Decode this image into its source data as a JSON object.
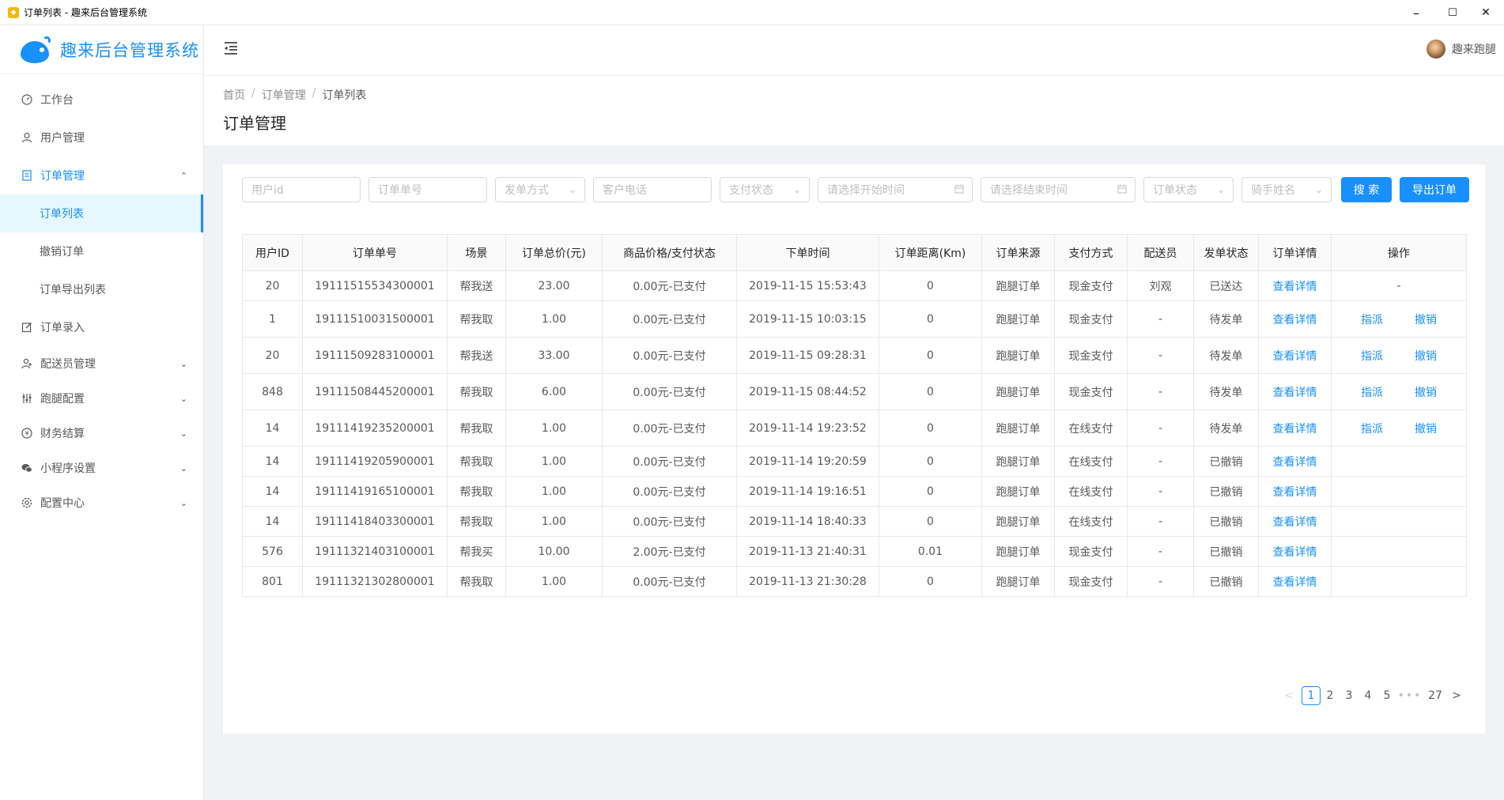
{
  "window": {
    "title": "订单列表 - 趣来后台管理系统",
    "minimize": "–",
    "maximize": "☐",
    "close": "✕"
  },
  "brand": {
    "name": "趣来后台管理系统"
  },
  "sidebar": {
    "items": [
      {
        "label": "工作台",
        "icon": "dashboard-icon"
      },
      {
        "label": "用户管理",
        "icon": "user-icon"
      },
      {
        "label": "订单管理",
        "icon": "file-icon",
        "open": true,
        "children": [
          {
            "label": "订单列表",
            "active": true
          },
          {
            "label": "撤销订单"
          },
          {
            "label": "订单导出列表"
          }
        ]
      },
      {
        "label": "订单录入",
        "icon": "edit-icon"
      },
      {
        "label": "配送员管理",
        "icon": "courier-icon",
        "arrow": true
      },
      {
        "label": "跑腿配置",
        "icon": "sliders-icon",
        "arrow": true
      },
      {
        "label": "财务结算",
        "icon": "money-icon",
        "arrow": true
      },
      {
        "label": "小程序设置",
        "icon": "wechat-icon",
        "arrow": true
      },
      {
        "label": "配置中心",
        "icon": "gear-icon",
        "arrow": true
      }
    ]
  },
  "header": {
    "username": "趣来跑腿"
  },
  "breadcrumb": [
    "首页",
    "订单管理",
    "订单列表"
  ],
  "page_title": "订单管理",
  "filters": {
    "user_id": "用户id",
    "order_no": "订单单号",
    "dispatch_mode": "发单方式",
    "customer_phone": "客户电话",
    "pay_status": "支付状态",
    "start_time": "请选择开始时间",
    "end_time": "请选择结束时间",
    "order_status": "订单状态",
    "rider_name": "骑手姓名",
    "search_label": "搜 索",
    "export_label": "导出订单"
  },
  "table": {
    "columns": [
      "用户ID",
      "订单单号",
      "场景",
      "订单总价(元)",
      "商品价格/支付状态",
      "下单时间",
      "订单距离(Km)",
      "订单来源",
      "支付方式",
      "配送员",
      "发单状态",
      "订单详情",
      "操作"
    ],
    "detail_label": "查看详情",
    "assign_label": "指派",
    "revoke_label": "撤销",
    "rows": [
      {
        "user_id": "20",
        "order_no": "19111515534300001",
        "scene": "帮我送",
        "total": "23.00",
        "goods": "0.00元-已支付",
        "time": "2019-11-15 15:53:43",
        "distance": "0",
        "source": "跑腿订单",
        "pay": "现金支付",
        "courier": "刘观",
        "status": "已送达",
        "op": "-"
      },
      {
        "user_id": "1",
        "order_no": "19111510031500001",
        "scene": "帮我取",
        "total": "1.00",
        "goods": "0.00元-已支付",
        "time": "2019-11-15 10:03:15",
        "distance": "0",
        "source": "跑腿订单",
        "pay": "现金支付",
        "courier": "-",
        "status": "待发单",
        "op": "actions"
      },
      {
        "user_id": "20",
        "order_no": "19111509283100001",
        "scene": "帮我送",
        "total": "33.00",
        "goods": "0.00元-已支付",
        "time": "2019-11-15 09:28:31",
        "distance": "0",
        "source": "跑腿订单",
        "pay": "现金支付",
        "courier": "-",
        "status": "待发单",
        "op": "actions"
      },
      {
        "user_id": "848",
        "order_no": "19111508445200001",
        "scene": "帮我取",
        "total": "6.00",
        "goods": "0.00元-已支付",
        "time": "2019-11-15 08:44:52",
        "distance": "0",
        "source": "跑腿订单",
        "pay": "现金支付",
        "courier": "-",
        "status": "待发单",
        "op": "actions"
      },
      {
        "user_id": "14",
        "order_no": "19111419235200001",
        "scene": "帮我取",
        "total": "1.00",
        "goods": "0.00元-已支付",
        "time": "2019-11-14 19:23:52",
        "distance": "0",
        "source": "跑腿订单",
        "pay": "在线支付",
        "courier": "-",
        "status": "待发单",
        "op": "actions"
      },
      {
        "user_id": "14",
        "order_no": "19111419205900001",
        "scene": "帮我取",
        "total": "1.00",
        "goods": "0.00元-已支付",
        "time": "2019-11-14 19:20:59",
        "distance": "0",
        "source": "跑腿订单",
        "pay": "在线支付",
        "courier": "-",
        "status": "已撤销",
        "op": ""
      },
      {
        "user_id": "14",
        "order_no": "19111419165100001",
        "scene": "帮我取",
        "total": "1.00",
        "goods": "0.00元-已支付",
        "time": "2019-11-14 19:16:51",
        "distance": "0",
        "source": "跑腿订单",
        "pay": "在线支付",
        "courier": "-",
        "status": "已撤销",
        "op": ""
      },
      {
        "user_id": "14",
        "order_no": "19111418403300001",
        "scene": "帮我取",
        "total": "1.00",
        "goods": "0.00元-已支付",
        "time": "2019-11-14 18:40:33",
        "distance": "0",
        "source": "跑腿订单",
        "pay": "在线支付",
        "courier": "-",
        "status": "已撤销",
        "op": ""
      },
      {
        "user_id": "576",
        "order_no": "19111321403100001",
        "scene": "帮我买",
        "total": "10.00",
        "goods": "2.00元-已支付",
        "time": "2019-11-13 21:40:31",
        "distance": "0.01",
        "source": "跑腿订单",
        "pay": "现金支付",
        "courier": "-",
        "status": "已撤销",
        "op": ""
      },
      {
        "user_id": "801",
        "order_no": "19111321302800001",
        "scene": "帮我取",
        "total": "1.00",
        "goods": "0.00元-已支付",
        "time": "2019-11-13 21:30:28",
        "distance": "0",
        "source": "跑腿订单",
        "pay": "现金支付",
        "courier": "-",
        "status": "已撤销",
        "op": ""
      }
    ]
  },
  "pagination": {
    "prev": "<",
    "next": ">",
    "pages": [
      "1",
      "2",
      "3",
      "4",
      "5"
    ],
    "ellipsis": "•••",
    "last": "27",
    "current": "1"
  },
  "colors": {
    "primary": "#1890ff",
    "active_menu_bg": "#e6f7ff"
  }
}
